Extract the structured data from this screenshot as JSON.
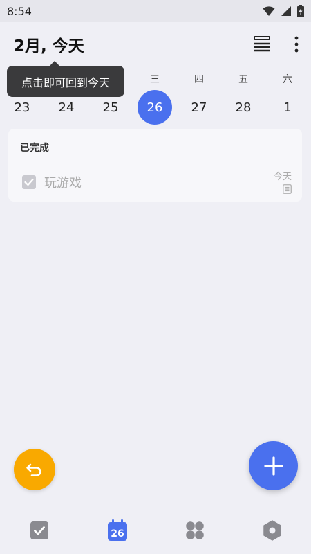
{
  "status": {
    "time": "8:54"
  },
  "header": {
    "title": "2月, 今天"
  },
  "tooltip": {
    "text": "点击即可回到今天"
  },
  "week": {
    "days": [
      {
        "weekday": "",
        "date": "23"
      },
      {
        "weekday": "",
        "date": "24"
      },
      {
        "weekday": "",
        "date": "25"
      },
      {
        "weekday": "三",
        "date": "26",
        "selected": true
      },
      {
        "weekday": "四",
        "date": "27"
      },
      {
        "weekday": "五",
        "date": "28"
      },
      {
        "weekday": "六",
        "date": "1"
      }
    ]
  },
  "completed": {
    "title": "已完成",
    "task": {
      "label": "玩游戏",
      "date": "今天",
      "checked": true
    }
  },
  "nav": {
    "calendar_day": "26"
  },
  "colors": {
    "accent": "#4a70ee",
    "undo": "#f9a900",
    "tooltip_bg": "#3a3a3c"
  }
}
